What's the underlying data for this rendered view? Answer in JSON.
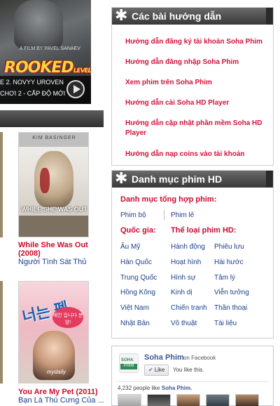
{
  "left": {
    "hero": {
      "credit": "A FILM BY PAVEL SANAEV",
      "logo_text": "ROOKED",
      "logo_suffix": "LEVEL",
      "logo_number": "2",
      "caption_line1": "E 2. NOVYY UROVEN",
      "caption_line2": "CHƠI 2 - CẤP ĐỘ MỚI"
    },
    "films": [
      {
        "poster_actor": "KIM BASINGER",
        "poster_title": "WHILE SHE WAS OUT",
        "title_en": "While She Was Out",
        "year": "(2008)",
        "title_vi": "Người Tình Sát Thủ"
      },
      {
        "poster_title": "너는 펫",
        "poster_tagline": "애인 입니다 분양!",
        "poster_brand": "mydaily",
        "title_en": "You Are My Pet (2011)",
        "title_vi": "Bạn Là Thú Cưng Của ..."
      }
    ]
  },
  "tutorials": {
    "header": "Các bài hướng dẫn",
    "links": [
      "Hướng dẫn đăng ký tài khoản Soha Phim",
      "Hướng dẫn đăng nhập Soha Phim",
      "Xem phim trên Soha Phim",
      "Hướng dẫn cài Soha HD Player",
      "Hướng dẫn cập nhật phần mềm Soha HD Player",
      "Hướng dẫn nạp coins vào tài khoản"
    ]
  },
  "categories": {
    "header": "Danh mục phim HD",
    "summary_label": "Danh mục tổng hợp phim:",
    "summary_links": [
      "Phim bộ",
      "Phim lẻ"
    ],
    "country_label": "Quốc gia:",
    "countries": [
      "Âu Mỹ",
      "Hàn Quốc",
      "Trung Quốc",
      "Hồng Kông",
      "Việt Nam",
      "Nhật Bản"
    ],
    "genre_label": "Thể loại phim HD:",
    "genres": [
      "Hành động",
      "Phiêu lưu",
      "Hoạt hình",
      "Hài hước",
      "Hình sự",
      "Tâm lý",
      "Kinh dị",
      "Viễn tưởng",
      "Chiến tranh",
      "Thần thoại",
      "Võ thuật",
      "Tài liệu"
    ]
  },
  "facebook": {
    "logo_top": "SOHA",
    "logo_bottom": "PHIM",
    "page_name": "Soha Phim",
    "on_text": "on Facebook",
    "like_button": "Like",
    "you_like": "You like this.",
    "count_text": "4,232 people like",
    "count_name": "Soha Phim.",
    "brand_color": "#3b5998"
  },
  "colors": {
    "link_red": "#cc0a2c",
    "link_blue": "#1a3f8a",
    "header_dark": "#383838"
  }
}
